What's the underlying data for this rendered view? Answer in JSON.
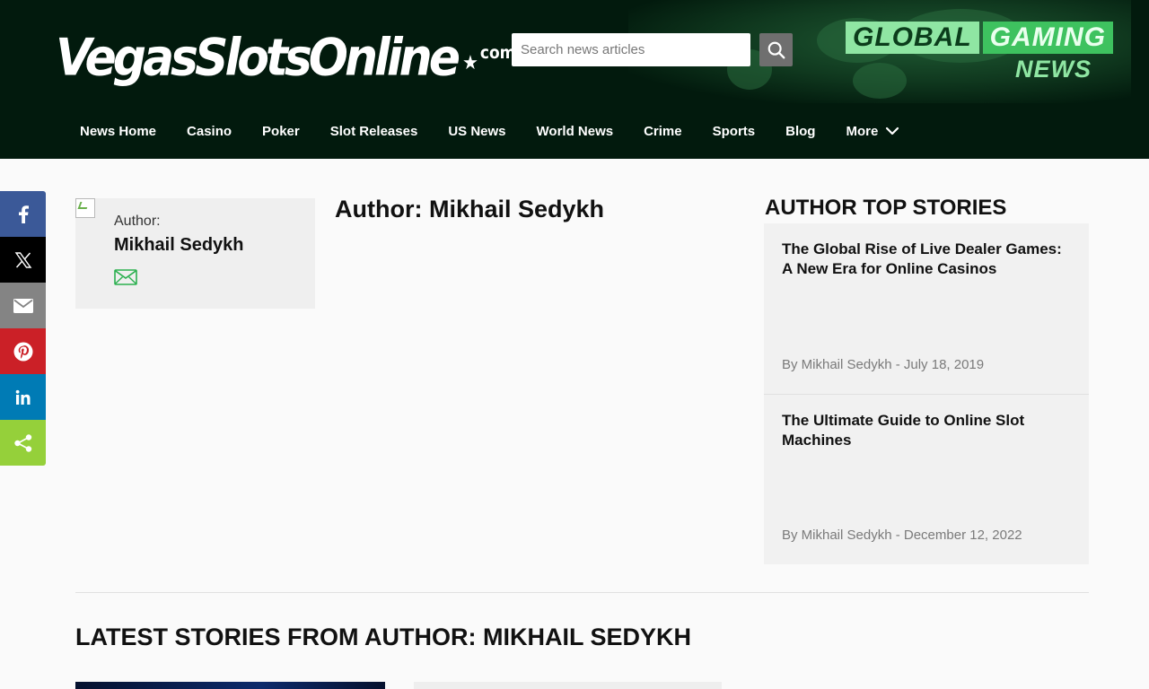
{
  "header": {
    "logo_main": "VegasSlotsOnline",
    "logo_star": "★",
    "logo_suffix": "com",
    "search": {
      "placeholder": "Search news articles"
    },
    "brand": {
      "global": "GLOBAL",
      "gaming": "GAMING",
      "news": "NEWS"
    }
  },
  "nav": {
    "items": [
      {
        "label": "News Home"
      },
      {
        "label": "Casino"
      },
      {
        "label": "Poker"
      },
      {
        "label": "Slot Releases"
      },
      {
        "label": "US News"
      },
      {
        "label": "World News"
      },
      {
        "label": "Crime"
      },
      {
        "label": "Sports"
      },
      {
        "label": "Blog"
      },
      {
        "label": "More"
      }
    ]
  },
  "share": {
    "buttons": [
      {
        "icon": "facebook-icon",
        "color": "#3b5998"
      },
      {
        "icon": "x-icon",
        "color": "#000000"
      },
      {
        "icon": "email-icon",
        "color": "#848484"
      },
      {
        "icon": "pinterest-icon",
        "color": "#cb2027"
      },
      {
        "icon": "linkedin-icon",
        "color": "#007bb5"
      },
      {
        "icon": "share-icon",
        "color": "#95d03a"
      }
    ]
  },
  "author": {
    "label": "Author:",
    "name": "Mikhail Sedykh"
  },
  "page_title": "Author: Mikhail Sedykh",
  "top_stories": {
    "heading": "AUTHOR TOP STORIES",
    "items": [
      {
        "title": "The Global Rise of Live Dealer Games: A New Era for Online Casinos",
        "meta": "By Mikhail Sedykh - July 18, 2019"
      },
      {
        "title": "The Ultimate Guide to Online Slot Machines",
        "meta": "By Mikhail Sedykh - December 12, 2022"
      }
    ]
  },
  "latest": {
    "heading": "LATEST STORIES FROM AUTHOR: MIKHAIL SEDYKH"
  },
  "colors": {
    "header_bg": "#021a0d",
    "accent_green": "#3ec25f",
    "mail_icon": "#2bb04f"
  }
}
